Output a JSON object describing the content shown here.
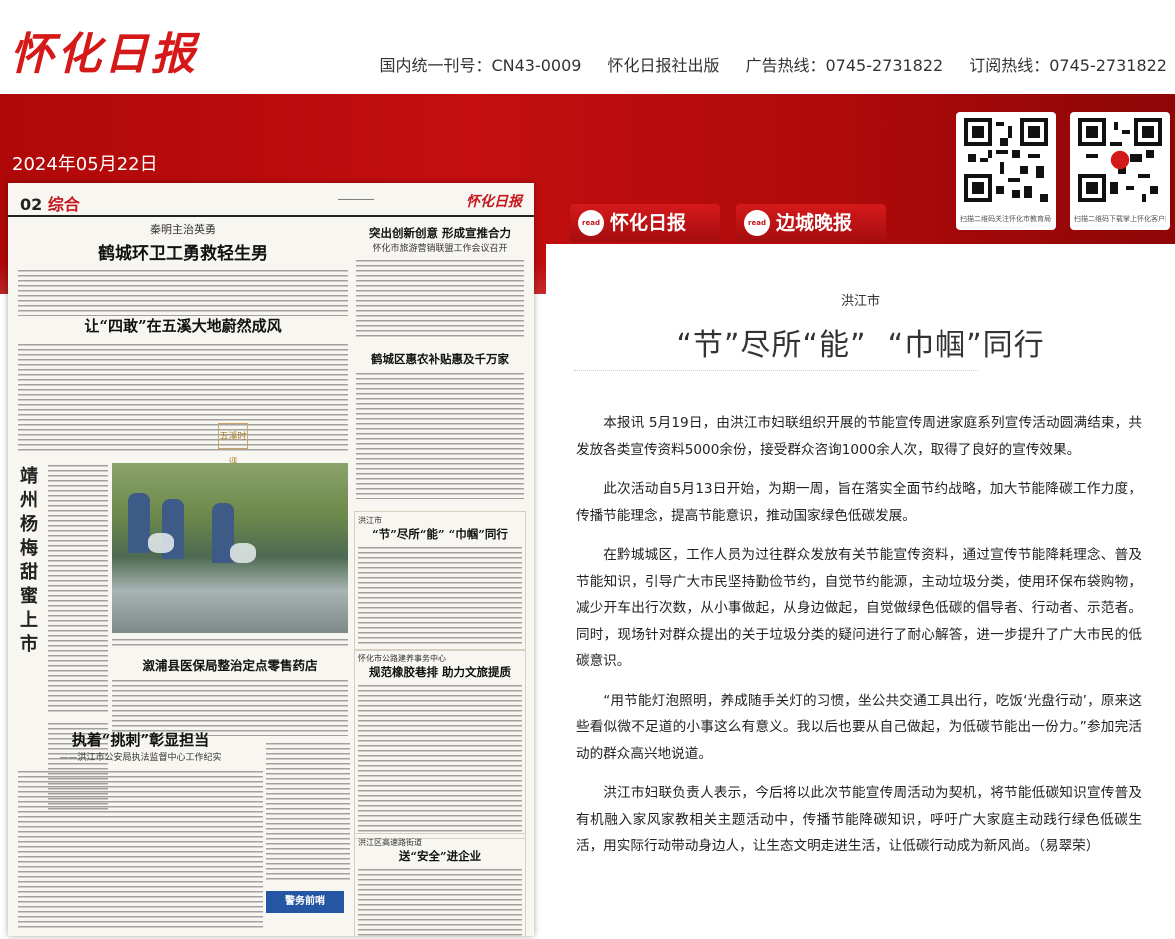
{
  "header": {
    "logo": "怀化日报",
    "issn": "国内统一刊号：CN43-0009",
    "publisher": "怀化日报社出版",
    "ad_hotline": "广告热线：0745-2731822",
    "sub_hotline": "订阅热线：0745-2731822"
  },
  "date": "2024年05月22日",
  "qr_codes": [
    {
      "caption": "扫描二维码关注怀化市教育局公众号"
    },
    {
      "caption": "扫描二维码下载掌上怀化客户端"
    }
  ],
  "tabs": [
    {
      "read": "read",
      "label": "怀化日报"
    },
    {
      "read": "read",
      "label": "边城晚报"
    }
  ],
  "page": {
    "number": "02",
    "section": "综合",
    "masthead": "怀化日报",
    "headlines": {
      "top_kicker": "秦明主治英勇",
      "top": "鹤城环卫工勇救轻生男",
      "second": "让“四敢”在五溪大地蔚然成风",
      "vertical": "靖州杨梅甜蜜上市",
      "right1": "突出创新创意 形成宣推合力",
      "right1_sub": "怀化市旅游营销联盟工作会议召开",
      "right2": "鹤城区惠农补贴惠及千万家",
      "right3_kicker": "洪江市",
      "right3": "“节”尽所“能” “巾帼”同行",
      "center": "溆浦县医保局整治定点零售药店",
      "right4_kicker": "怀化市公路建养事务中心",
      "right4": "规范橡胶巷排 助力文旅提质",
      "bottom": "执着“挑刺”彰显担当",
      "bottom_sub": "——洪江市公安局执法监督中心工作纪实",
      "right5_kicker": "洪江区高速路街道",
      "right5": "送“安全”进企业",
      "stamp": "五溪时评",
      "police": "警务前哨"
    }
  },
  "article": {
    "kicker": "洪江市",
    "title": "“节”尽所“能”  “巾帼”同行",
    "paragraphs": [
      "本报讯 5月19日，由洪江市妇联组织开展的节能宣传周进家庭系列宣传活动圆满结束，共发放各类宣传资料5000余份，接受群众咨询1000余人次，取得了良好的宣传效果。",
      "此次活动自5月13日开始，为期一周，旨在落实全面节约战略，加大节能降碳工作力度，传播节能理念，提高节能意识，推动国家绿色低碳发展。",
      "在黔城城区，工作人员为过往群众发放有关节能宣传资料，通过宣传节能降耗理念、普及节能知识，引导广大市民坚持勤俭节约，自觉节约能源，主动垃圾分类，使用环保布袋购物，减少开车出行次数，从小事做起，从身边做起，自觉做绿色低碳的倡导者、行动者、示范者。同时，现场针对群众提出的关于垃圾分类的疑问进行了耐心解答，进一步提升了广大市民的低碳意识。",
      "“用节能灯泡照明，养成随手关灯的习惯，坐公共交通工具出行，吃饭‘光盘行动’，原来这些看似微不足道的小事这么有意义。我以后也要从自己做起，为低碳节能出一份力。”参加完活动的群众高兴地说道。",
      "洪江市妇联负责人表示，今后将以此次节能宣传周活动为契机，将节能低碳知识宣传普及有机融入家风家教相关主题活动中，传播节能降碳知识，呼吁广大家庭主动践行绿色低碳生活，用实际行动带动身边人，让生态文明走进生活，让低碳行动成为新风尚。（易翠荣）"
    ]
  }
}
